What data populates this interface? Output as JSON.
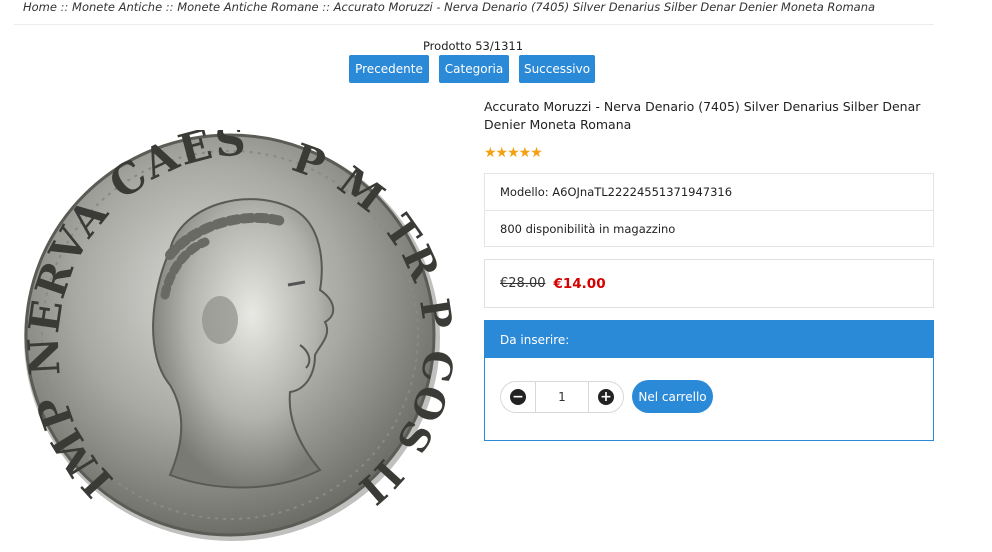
{
  "breadcrumb": {
    "items": [
      "Home",
      "Monete Antiche",
      "Monete Antiche Romane",
      "Accurato Moruzzi - Nerva Denario (7405) Silver Denarius Silber Denar Denier Moneta Romana"
    ],
    "separator": "::"
  },
  "pager": {
    "counter": "Prodotto 53/1311",
    "prev_label": "Precedente",
    "category_label": "Categoria",
    "next_label": "Successivo"
  },
  "product": {
    "title": "Accurato Moruzzi - Nerva Denario (7405) Silver Denarius Silber Denar Denier Moneta Romana",
    "rating_stars": "★★★★★",
    "rating": 5,
    "model": "Modello: A6OJnaTL22224551371947316",
    "stock": "800 disponibilità in magazzino",
    "old_price": "€28.00",
    "new_price": "€14.00",
    "coin_legend_left": "IMP NERVA CAES AVG",
    "coin_legend_right": "P M TR P COS III P P"
  },
  "cart": {
    "header": "Da inserire:",
    "quantity": "1",
    "add_label": "Nel carrello",
    "minus_icon": "minus-circle-icon",
    "plus_icon": "plus-circle-icon"
  },
  "colors": {
    "accent": "#2b8ad8",
    "price_sale": "#d60000",
    "stars": "#f5a012"
  }
}
